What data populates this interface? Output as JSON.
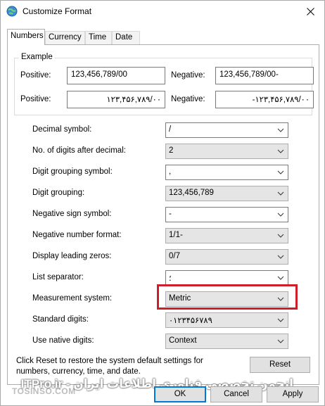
{
  "window": {
    "title": "Customize Format"
  },
  "tabs": [
    {
      "label": "Numbers"
    },
    {
      "label": "Currency"
    },
    {
      "label": "Time"
    },
    {
      "label": "Date"
    }
  ],
  "example": {
    "legend": "Example",
    "row1": {
      "positive_label": "Positive:",
      "positive_value": "123,456,789/00",
      "negative_label": "Negative:",
      "negative_value": "123,456,789/00-"
    },
    "row2": {
      "positive_label": "Positive:",
      "positive_value": "۱۲۳,۴۵۶,۷۸۹/۰۰",
      "negative_label": "Negative:",
      "negative_value": "-۱۲۳,۴۵۶,۷۸۹/۰۰"
    }
  },
  "settings": [
    {
      "label": "Decimal symbol:",
      "value": "/",
      "editable": true
    },
    {
      "label": "No. of digits after decimal:",
      "value": "2",
      "editable": false
    },
    {
      "label": "Digit grouping symbol:",
      "value": ",",
      "editable": true
    },
    {
      "label": "Digit grouping:",
      "value": "123,456,789",
      "editable": false
    },
    {
      "label": "Negative sign symbol:",
      "value": "-",
      "editable": true
    },
    {
      "label": "Negative number format:",
      "value": "1/1-",
      "editable": false
    },
    {
      "label": "Display leading zeros:",
      "value": "0/7",
      "editable": false
    },
    {
      "label": "List separator:",
      "value": "؛",
      "editable": true
    },
    {
      "label": "Measurement system:",
      "value": "Metric",
      "editable": false
    },
    {
      "label": "Standard digits:",
      "value": "۰۱۲۳۴۵۶۷۸۹",
      "editable": false
    },
    {
      "label": "Use native digits:",
      "value": "Context",
      "editable": false
    }
  ],
  "footer": {
    "note": "Click Reset to restore the system default settings for numbers, currency, time, and date.",
    "reset_label": "Reset",
    "ok_label": "OK",
    "cancel_label": "Cancel",
    "apply_label": "Apply"
  },
  "watermarks": {
    "left": "TOSINSO.COM",
    "right": "ITPro.ir - انجمن تخصصی فناوری اطلاعات ایران"
  },
  "colors": {
    "highlight": "#cc1f2b",
    "default_button": "#0078d7"
  }
}
